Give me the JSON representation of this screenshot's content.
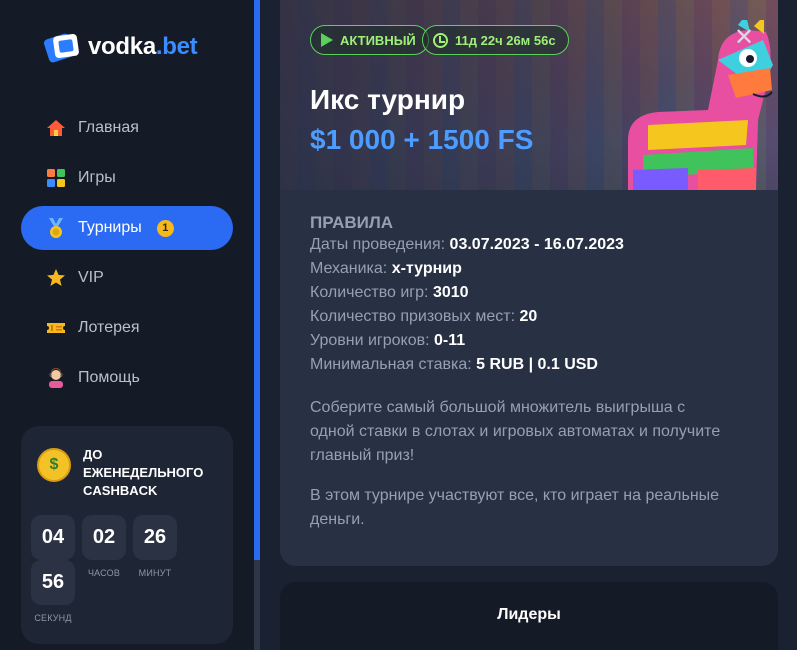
{
  "brand": {
    "name": "vodka",
    "tld": ".bet",
    "logo_icon": "card-logo-icon"
  },
  "nav": {
    "items": [
      {
        "label": "Главная",
        "icon": "home-icon",
        "active": false
      },
      {
        "label": "Игры",
        "icon": "games-grid-icon",
        "active": false
      },
      {
        "label": "Турниры",
        "icon": "medal-icon",
        "active": true,
        "badge": "1"
      },
      {
        "label": "VIP",
        "icon": "star-icon",
        "active": false
      },
      {
        "label": "Лотерея",
        "icon": "ticket-icon",
        "active": false
      },
      {
        "label": "Помощь",
        "icon": "support-agent-icon",
        "active": false
      }
    ]
  },
  "cashback": {
    "title": "До еженедельного cashback",
    "icon": "money-face-icon",
    "timer": [
      {
        "value": "04",
        "label": ""
      },
      {
        "value": "02",
        "label": "часов"
      },
      {
        "value": "26",
        "label": "минут"
      },
      {
        "value": "56",
        "label": "секунд"
      }
    ]
  },
  "tournament": {
    "status": "АКТИВНЫЙ",
    "time_left": "11д 22ч 26м 56с",
    "title": "Икс турнир",
    "prize": "$1 000 + 1500 FS",
    "close_icon": "close-icon"
  },
  "rules": {
    "heading": "ПРАВИЛА",
    "rows": [
      {
        "label": "Даты проведения: ",
        "value": "03.07.2023 - 16.07.2023"
      },
      {
        "label": "Механика: ",
        "value": "х-турнир"
      },
      {
        "label": "Количество игр: ",
        "value": "3010"
      },
      {
        "label": "Количество призовых мест: ",
        "value": "20"
      },
      {
        "label": "Уровни игроков: ",
        "value": "0-11"
      },
      {
        "label": "Минимальная ставка: ",
        "value": "5 RUB | 0.1 USD"
      }
    ],
    "paragraph1": "Соберите самый большой множитель выигрыша с одной ставки в слотах и игровых автоматах и получите главный приз!",
    "paragraph2": "В этом турнире участвуют все, кто играет на реальные деньги."
  },
  "leaders": {
    "title": "Лидеры"
  },
  "colors": {
    "accent": "#2b6bf3",
    "prize": "#4d9cff",
    "status_green": "#58d25a",
    "badge": "#f5b81e"
  }
}
